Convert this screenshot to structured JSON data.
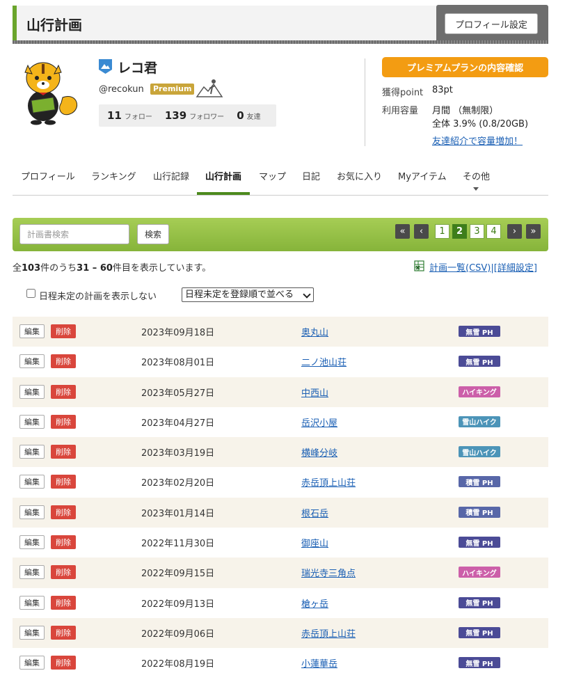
{
  "header": {
    "title": "山行計画",
    "profile_button": "プロフィール設定"
  },
  "user": {
    "name": "レコ君",
    "handle": "@recokun",
    "premium_label": "Premium",
    "follow_count": "11",
    "follow_label": "フォロー",
    "follower_count": "139",
    "follower_label": "フォロワー",
    "friend_count": "0",
    "friend_label": "友達"
  },
  "account": {
    "plan_button": "プレミアムプランの内容確認",
    "points_label": "獲得point",
    "points_value": "83pt",
    "capacity_label": "利用容量",
    "capacity_monthly": "月間 （無制限）",
    "capacity_total": "全体 3.9% (0.8/20GB)",
    "invite_link": "友達紹介で容量増加！"
  },
  "nav": {
    "items": [
      "プロフィール",
      "ランキング",
      "山行記録",
      "山行計画",
      "マップ",
      "日記",
      "お気に入り",
      "Myアイテム",
      "その他"
    ]
  },
  "search": {
    "placeholder": "計画書検索",
    "button": "検索"
  },
  "pagination": {
    "first": "«",
    "prev": "‹",
    "pages": [
      "1",
      "2",
      "3",
      "4"
    ],
    "next": "›",
    "last": "»"
  },
  "summary": {
    "prefix": "全",
    "total": "103",
    "mid": "件のうち",
    "range": "31 – 60",
    "suffix": "件目を表示しています。"
  },
  "csv": {
    "label": "計画一覧(CSV)",
    "sep": "|",
    "detail": "[詳細設定]"
  },
  "filters": {
    "hide_undated": "日程未定の計画を表示しない",
    "sort_option": "日程未定を登録順で並べる"
  },
  "colors": {
    "tag_none": "#4b4b96",
    "tag_hike": "#cc5fa9",
    "tag_snow": "#4c94b8",
    "tag_deep": "#5867a8"
  },
  "plans": {
    "edit_label": "編集",
    "delete_label": "削除",
    "rows": [
      {
        "date": "2023年09月18日",
        "dest": "奥丸山",
        "tag": "無雪 PH",
        "kind": "none"
      },
      {
        "date": "2023年08月01日",
        "dest": "二ノ池山荘",
        "tag": "無雪 PH",
        "kind": "none"
      },
      {
        "date": "2023年05月27日",
        "dest": "中西山",
        "tag": "ハイキング",
        "kind": "hike"
      },
      {
        "date": "2023年04月27日",
        "dest": "岳沢小屋",
        "tag": "雪山ハイク",
        "kind": "snow"
      },
      {
        "date": "2023年03月19日",
        "dest": "横峰分岐",
        "tag": "雪山ハイク",
        "kind": "snow"
      },
      {
        "date": "2023年02月20日",
        "dest": "赤岳頂上山荘",
        "tag": "積雪 PH",
        "kind": "deep"
      },
      {
        "date": "2023年01月14日",
        "dest": "根石岳",
        "tag": "積雪 PH",
        "kind": "deep"
      },
      {
        "date": "2022年11月30日",
        "dest": "御座山",
        "tag": "無雪 PH",
        "kind": "none"
      },
      {
        "date": "2022年09月15日",
        "dest": "瑞光寺三角点",
        "tag": "ハイキング",
        "kind": "hike"
      },
      {
        "date": "2022年09月13日",
        "dest": "槍ヶ岳",
        "tag": "無雪 PH",
        "kind": "none"
      },
      {
        "date": "2022年09月06日",
        "dest": "赤岳頂上山荘",
        "tag": "無雪 PH",
        "kind": "none"
      },
      {
        "date": "2022年08月19日",
        "dest": "小蓮華岳",
        "tag": "無雪 PH",
        "kind": "none"
      }
    ]
  }
}
